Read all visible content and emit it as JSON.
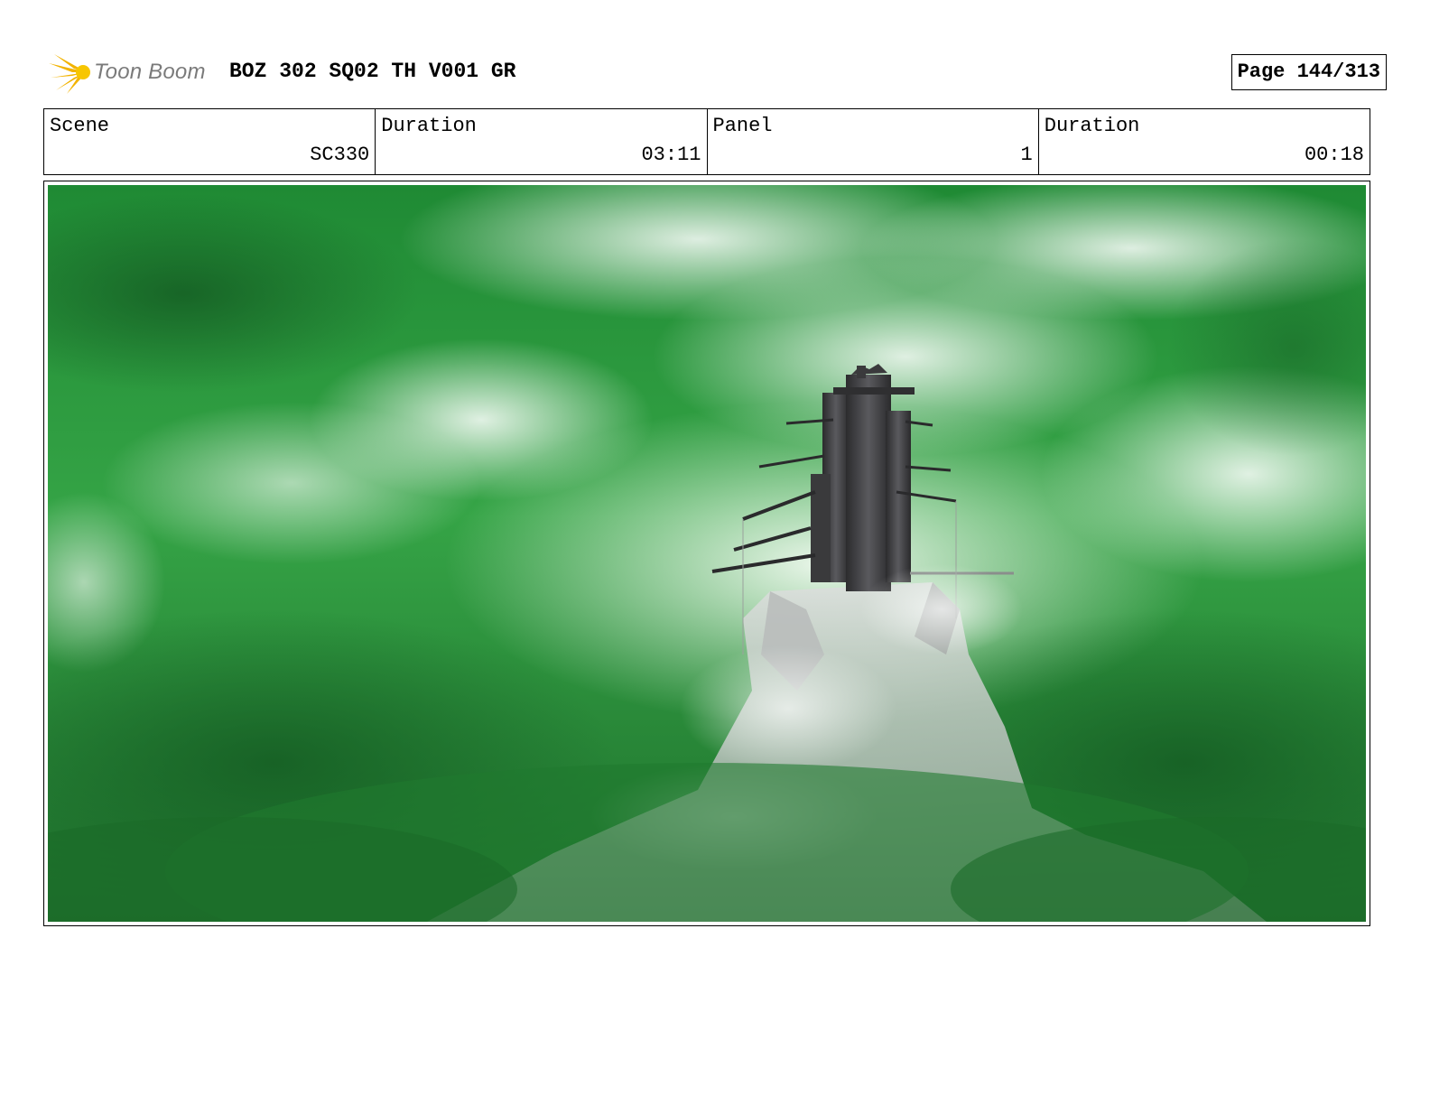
{
  "header": {
    "logo_text": "Toon Boom",
    "title": "BOZ 302 SQ02 TH V001 GR",
    "page": "Page 144/313"
  },
  "info": {
    "scene_label": "Scene",
    "scene_value": "SC330",
    "scene_duration_label": "Duration",
    "scene_duration_value": "03:11",
    "panel_label": "Panel",
    "panel_value": "1",
    "panel_duration_label": "Duration",
    "panel_duration_value": "00:18"
  },
  "panel": {
    "image": "green-cloud-sky-with-dark-tower-on-rocky-peak",
    "colors": {
      "sky_dark": "#1f7a2e",
      "sky_mid": "#3ea84a",
      "cloud": "#e8f5e8",
      "tower": "#3a3a3c",
      "rock": "#c9cccb"
    }
  },
  "icons": [
    "toon-boom-logo-icon"
  ]
}
